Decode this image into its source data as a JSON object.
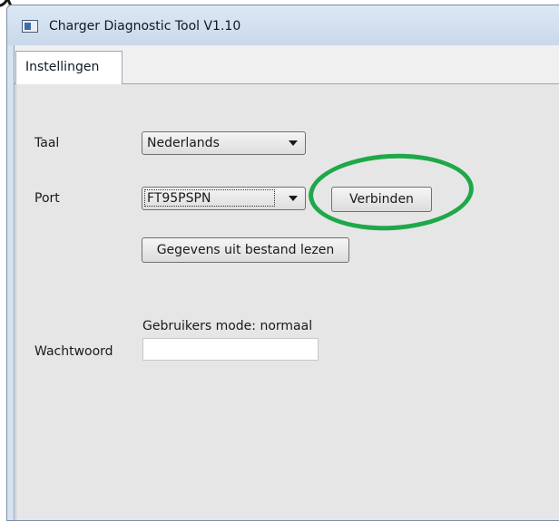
{
  "window": {
    "title": "Charger Diagnostic Tool V1.10"
  },
  "tabs": [
    {
      "label": "Instellingen",
      "selected": true
    }
  ],
  "settings": {
    "language_label": "Taal",
    "language_value": "Nederlands",
    "port_label": "Port",
    "port_value": "FT95PSPN",
    "connect_button": "Verbinden",
    "read_file_button": "Gegevens uit bestand lezen",
    "user_mode_text": "Gebruikers mode: normaal",
    "password_label": "Wachtwoord",
    "password_value": ""
  },
  "annotation": {
    "highlight_color": "#1fa84a",
    "highlights": "connect_button"
  },
  "icons": {
    "title": "app-window-icon"
  }
}
